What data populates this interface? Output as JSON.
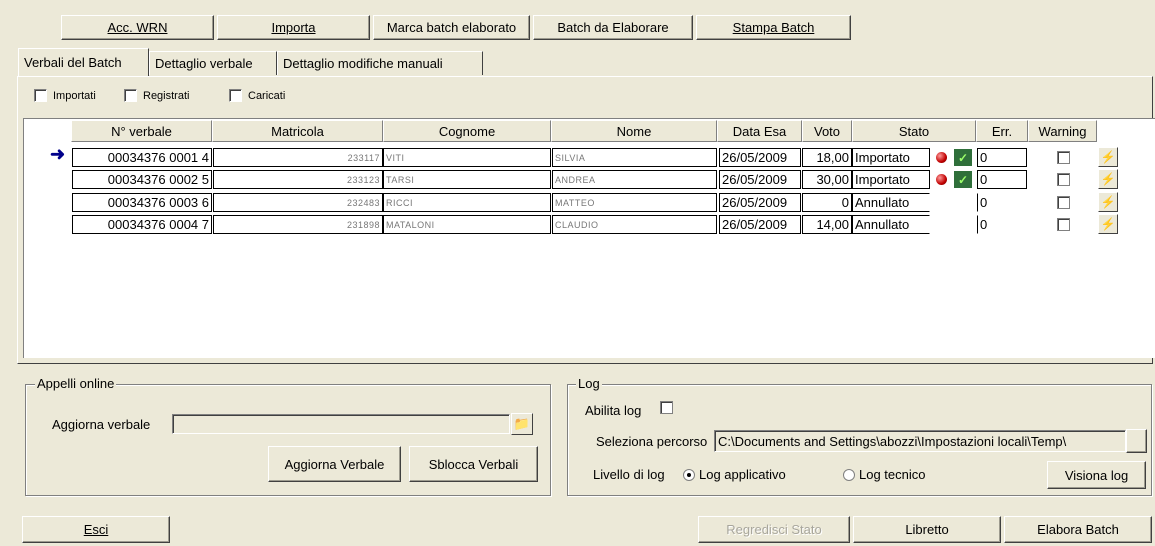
{
  "toolbar": {
    "acc_wrn": "Acc. WRN",
    "importa": "Importa",
    "marca": "Marca batch elaborato",
    "batch_da_elaborare": "Batch da Elaborare",
    "stampa": "Stampa Batch"
  },
  "tabs": [
    {
      "label": "Verbali del Batch"
    },
    {
      "label": "Dettaglio verbale"
    },
    {
      "label": "Dettaglio modifiche manuali"
    }
  ],
  "filters": {
    "importati": "Importati",
    "registrati": "Registrati",
    "caricati": "Caricati"
  },
  "table": {
    "columns": [
      "N° verbale",
      "Matricola",
      "Cognome",
      "Nome",
      "Data Esa",
      "Voto",
      "Stato",
      "Err.",
      "Warning"
    ],
    "rows": [
      {
        "verbale": "00034376 0001 4",
        "matricola": "233117",
        "cognome": "VITI",
        "nome": "SILVIA",
        "data": "26/05/2009",
        "voto": "18,00",
        "stato": "Importato",
        "err": "0",
        "leds": true,
        "current": true
      },
      {
        "verbale": "00034376 0002 5",
        "matricola": "233123",
        "cognome": "TARSI",
        "nome": "ANDREA",
        "data": "26/05/2009",
        "voto": "30,00",
        "stato": "Importato",
        "err": "0",
        "leds": true,
        "current": false
      },
      {
        "verbale": "00034376 0003 6",
        "matricola": "232483",
        "cognome": "RICCI",
        "nome": "MATTEO",
        "data": "26/05/2009",
        "voto": "0",
        "stato": "Annullato",
        "err": "0",
        "leds": false,
        "current": false
      },
      {
        "verbale": "00034376 0004 7",
        "matricola": "231898",
        "cognome": "MATALONI",
        "nome": "CLAUDIO",
        "data": "26/05/2009",
        "voto": "14,00",
        "stato": "Annullato",
        "err": "0",
        "leds": false,
        "current": false
      }
    ]
  },
  "appelli": {
    "title": "Appelli online",
    "aggiorna_label": "Aggiorna verbale",
    "aggiorna_value": "",
    "aggiorna_btn": "Aggiorna Verbale",
    "sblocca_btn": "Sblocca Verbali"
  },
  "log": {
    "title": "Log",
    "abilita": "Abilita log",
    "percorso_label": "Seleziona percorso",
    "percorso_value": "C:\\Documents and Settings\\abozzi\\Impostazioni locali\\Temp\\",
    "livello_label": "Livello di log",
    "applicativo": "Log applicativo",
    "tecnico": "Log tecnico",
    "visiona": "Visiona log"
  },
  "bottom": {
    "esci": "Esci",
    "regredisci": "Regredisci Stato",
    "libretto": "Libretto",
    "elabora": "Elabora Batch"
  }
}
